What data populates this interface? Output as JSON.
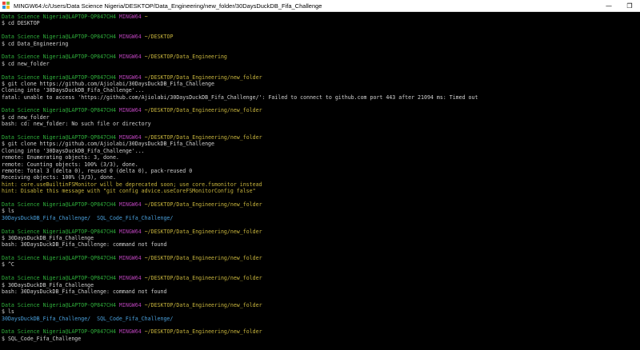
{
  "window": {
    "title": "MINGW64:/c/Users/Data Science Nigeria/DESKTOP/Data_Engineering/new_folder/30DaysDuckDB_Fifa_Challenge",
    "minimize": "—",
    "restore": "❐"
  },
  "prompt": {
    "user": "Data Science Nigeria@LAPTOP-QP847CH4",
    "shell": "MINGW64"
  },
  "blocks": [
    {
      "path": "~",
      "cmd": "$ cd DESKTOP",
      "out": []
    },
    {
      "path": "~/DESKTOP",
      "cmd": "$ cd Data_Engineering",
      "out": []
    },
    {
      "path": "~/DESKTOP/Data_Engineering",
      "cmd": "$ cd new_folder",
      "out": []
    },
    {
      "path": "~/DESKTOP/Data_Engineering/new_folder",
      "cmd": "$ git clone https://github.com/Ajiolabi/30DaysDuckDB_Fifa_Challenge",
      "out": [
        {
          "text": "Cloning into '30DaysDuckDB_Fifa_Challenge'..."
        },
        {
          "text": "fatal: unable to access 'https://github.com/Ajiolabi/30DaysDuckDB_Fifa_Challenge/': Failed to connect to github.com port 443 after 21094 ms: Timed out"
        }
      ]
    },
    {
      "path": "~/DESKTOP/Data_Engineering/new_folder",
      "cmd": "$ cd new_folder",
      "out": [
        {
          "text": "bash: cd: new_folder: No such file or directory"
        }
      ]
    },
    {
      "path": "~/DESKTOP/Data_Engineering/new_folder",
      "cmd": "$ git clone https://github.com/Ajiolabi/30DaysDuckDB_Fifa_Challenge",
      "out": [
        {
          "text": "Cloning into '30DaysDuckDB_Fifa_Challenge'..."
        },
        {
          "text": "remote: Enumerating objects: 3, done."
        },
        {
          "text": "remote: Counting objects: 100% (3/3), done."
        },
        {
          "text": "remote: Total 3 (delta 0), reused 0 (delta 0), pack-reused 0"
        },
        {
          "text": "Receiving objects: 100% (3/3), done."
        },
        {
          "text": "hint: core.useBuiltinFSMonitor will be deprecated soon; use core.fsmonitor instead",
          "kind": "hint"
        },
        {
          "text": "hint: Disable this message with \"git config advice.useCoreFSMonitorConfig false\"",
          "kind": "hint"
        }
      ]
    },
    {
      "path": "~/DESKTOP/Data_Engineering/new_folder",
      "cmd": "$ ls",
      "out": [
        {
          "text": "30DaysDuckDB_Fifa_Challenge/  SQL_Code_Fifa_Challenge/",
          "kind": "dir"
        }
      ]
    },
    {
      "path": "~/DESKTOP/Data_Engineering/new_folder",
      "cmd": "$ 30DaysDuckDB_Fifa_Challenge",
      "out": [
        {
          "text": "bash: 30DaysDuckDB_Fifa_Challenge: command not found"
        }
      ]
    },
    {
      "path": "~/DESKTOP/Data_Engineering/new_folder",
      "cmd": "$ ^C",
      "out": []
    },
    {
      "path": "~/DESKTOP/Data_Engineering/new_folder",
      "cmd": "$ 30DaysDuckDB_Fifa_Challenge",
      "out": [
        {
          "text": "bash: 30DaysDuckDB_Fifa_Challenge: command not found"
        }
      ]
    },
    {
      "path": "~/DESKTOP/Data_Engineering/new_folder",
      "cmd": "$ ls",
      "out": [
        {
          "text": "30DaysDuckDB_Fifa_Challenge/  SQL_Code_Fifa_Challenge/",
          "kind": "dir"
        }
      ]
    },
    {
      "path": "~/DESKTOP/Data_Engineering/new_folder",
      "cmd": "$ SQL_Code_Fifa_Challenge",
      "out": []
    }
  ],
  "colors": {
    "user": "#2fae3b",
    "shell": "#b742b7",
    "path": "#c7b43d",
    "text": "#d0d0d0",
    "dir": "#4aa0dc",
    "hint": "#c7b43d"
  }
}
